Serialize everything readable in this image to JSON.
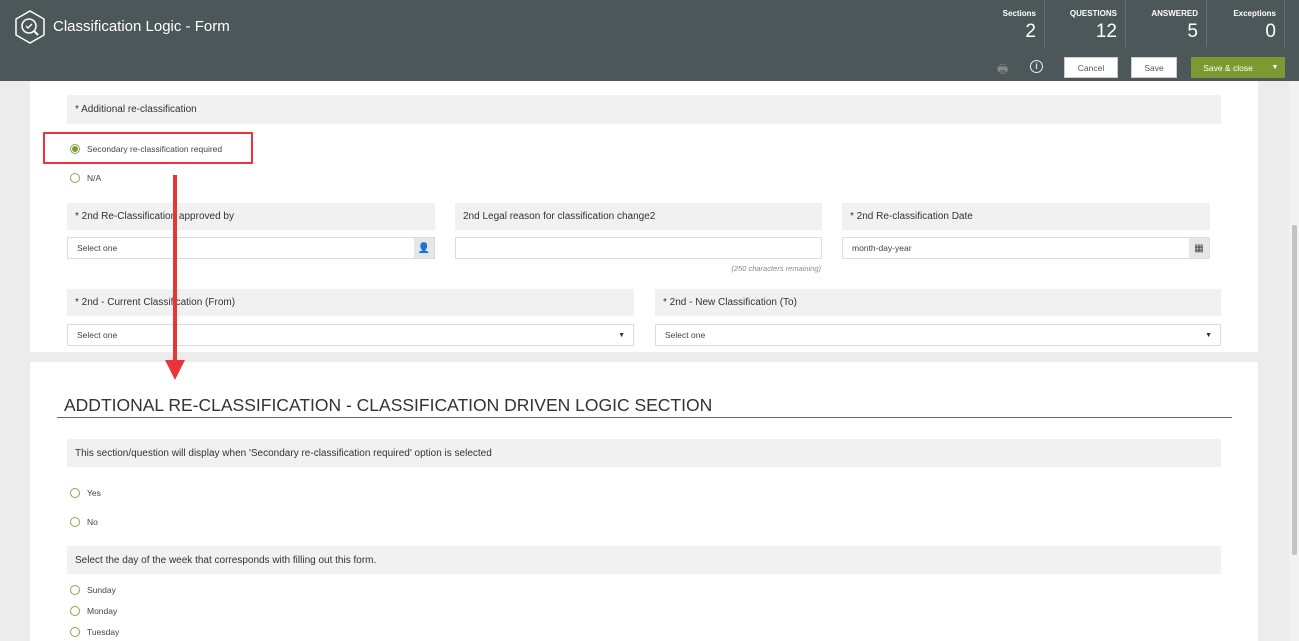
{
  "header": {
    "title": "Classification Logic - Form",
    "logo_icon": "magnifier-check-icon",
    "stats": [
      {
        "label": "Sections",
        "value": "2"
      },
      {
        "label": "QUESTIONS",
        "value": "12"
      },
      {
        "label": "ANSWERED",
        "value": "5"
      },
      {
        "label": "Exceptions",
        "value": "0"
      }
    ],
    "cancel": "Cancel",
    "save": "Save",
    "save_close": "Save & close"
  },
  "section1": {
    "question": "* Additional re-classification",
    "options": [
      {
        "label": "Secondary re-classification required",
        "selected": true
      },
      {
        "label": "N/A",
        "selected": false
      }
    ],
    "approved_by": {
      "label": "* 2nd Re-Classification approved by",
      "value": "Select one"
    },
    "legal_reason": {
      "label": "2nd Legal reason for classification change2",
      "value": "",
      "hint": "(250 characters remaining)"
    },
    "date": {
      "label": "* 2nd Re-classification Date",
      "placeholder": "month-day-year"
    },
    "from": {
      "label": "* 2nd - Current Classification (From)",
      "value": "Select one"
    },
    "to": {
      "label": "* 2nd - New Classification (To)",
      "value": "Select one"
    }
  },
  "section2": {
    "title": "ADDTIONAL RE-CLASSIFICATION - CLASSIFICATION DRIVEN LOGIC SECTION",
    "q1": "This section/question will display when 'Secondary re-classification required' option is selected",
    "q1_options": [
      "Yes",
      "No"
    ],
    "q2": "Select the day of the week that corresponds with filling out this form.",
    "q2_options": [
      "Sunday",
      "Monday",
      "Tuesday"
    ]
  },
  "annotation": {
    "highlight_color": "#e8343a"
  },
  "colors": {
    "header": "#4c5759",
    "accent": "#7c9a32"
  }
}
